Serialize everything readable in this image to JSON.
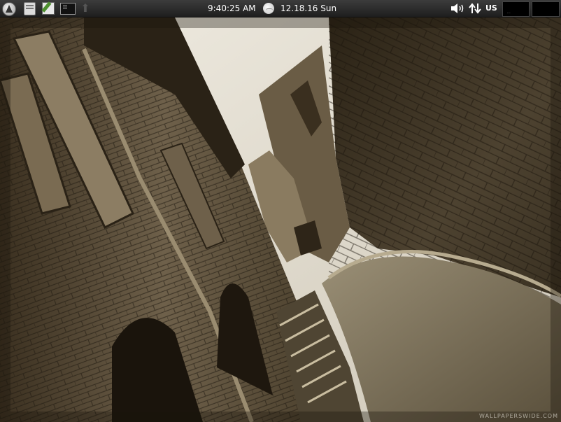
{
  "panel": {
    "time": "9:40:25 AM",
    "date": "12.18.16 Sun",
    "keyboard_layout": "US",
    "tray_mini_text": "...",
    "icons": {
      "menu": "app-menu-icon",
      "file_manager": "file-manager-icon",
      "text_editor": "text-editor-icon",
      "terminal": "terminal-icon",
      "up_arrow": "up-arrow-icon",
      "weather": "weather-icon",
      "volume": "volume-icon",
      "network": "network-icon"
    }
  },
  "wallpaper": {
    "watermark": "WALLPAPERSWIDE.COM",
    "palette": {
      "sky": "#e8e4da",
      "stone_dark": "#2e2518",
      "stone_mid": "#6b5d45",
      "stone_light": "#a8987a",
      "road": "#7a6e56"
    }
  }
}
